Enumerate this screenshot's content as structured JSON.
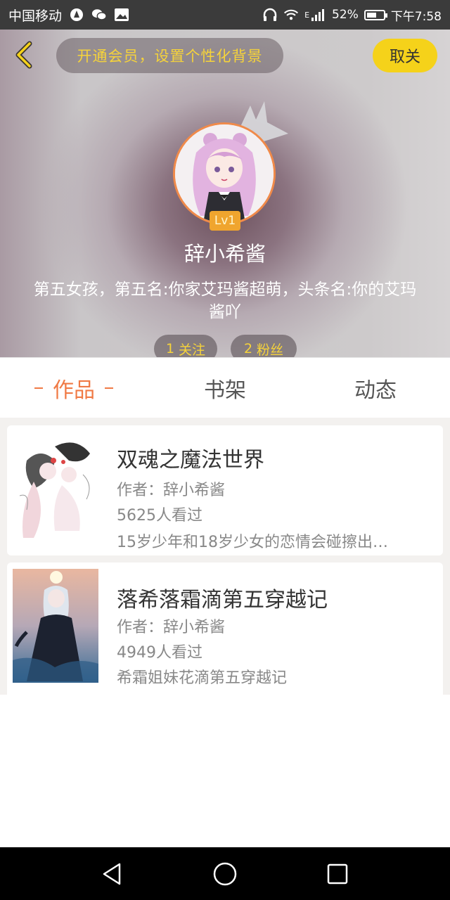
{
  "status_bar": {
    "carrier": "中国移动",
    "battery_percent": "52%",
    "time": "下午7:58",
    "network_label": "E"
  },
  "header": {
    "vip_prompt": "开通会员，设置个性化背景",
    "cancel_label": "取关",
    "level": "Lv1",
    "username": "辞小希酱",
    "bio": "第五女孩，第五名:你家艾玛酱超萌，头条名:你的艾玛酱吖",
    "following": {
      "count": "1",
      "label": "关注"
    },
    "fans": {
      "count": "2",
      "label": "粉丝"
    }
  },
  "tabs": [
    {
      "label": "作品",
      "active": true
    },
    {
      "label": "书架",
      "active": false
    },
    {
      "label": "动态",
      "active": false
    }
  ],
  "books": [
    {
      "title": "双魂之魔法世界",
      "author": "作者：辞小希酱",
      "views": "5625人看过",
      "summary": "15岁少年和18岁少女的恋情会碰擦出…"
    },
    {
      "title": "落希落霜滴第五穿越记",
      "author": "作者：辞小希酱",
      "views": "4949人看过",
      "summary": "希霜姐妹花滴第五穿越记"
    }
  ],
  "colors": {
    "accent": "#f07a45",
    "yellow": "#f5d21a",
    "gold_text": "#f6d33a"
  }
}
